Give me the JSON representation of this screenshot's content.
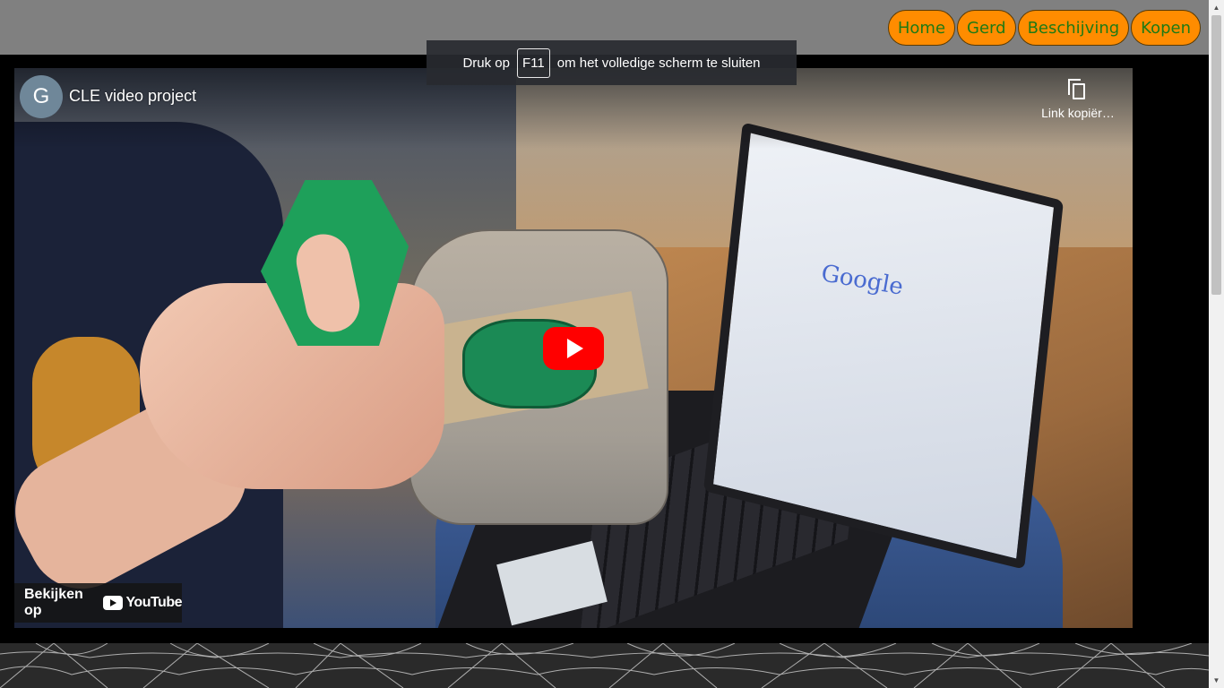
{
  "nav": {
    "items": [
      "Home",
      "Gerd",
      "Beschijving",
      "Kopen"
    ]
  },
  "video": {
    "channel_initial": "G",
    "title": "CLE video project",
    "copy_link_label": "Link kopiër…",
    "watch_on_label": "Bekijken op",
    "platform_name": "YouTube",
    "scene_text": "Google"
  },
  "fullscreen_toast": {
    "before": "Druk op",
    "key": "F11",
    "after": "om het volledige scherm te sluiten"
  },
  "colors": {
    "topbar": "#808080",
    "nav_button_bg": "#ff8c00",
    "nav_button_text": "#1f7a14",
    "play_button": "#ff0000",
    "page_bg": "#000000"
  },
  "icons": [
    "copy-icon",
    "play-icon",
    "youtube-logo-icon",
    "spider-web-decoration"
  ]
}
